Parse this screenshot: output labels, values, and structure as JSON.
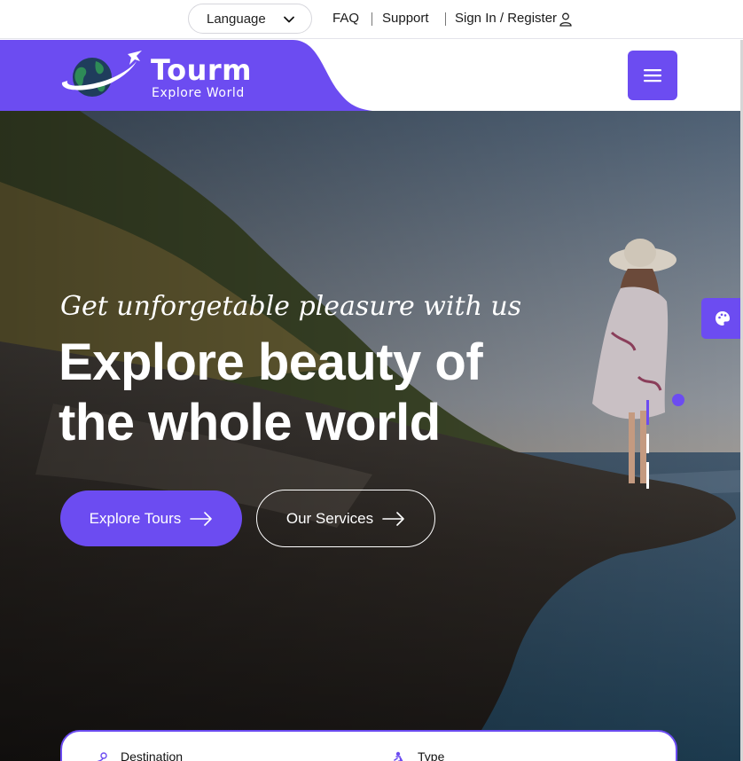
{
  "topbar": {
    "language_label": "Language",
    "links": [
      "FAQ",
      "Support",
      "Sign In / Register"
    ]
  },
  "brand": {
    "name": "Tourm",
    "tagline": "Explore World"
  },
  "hero": {
    "subtitle": "Get unforgetable pleasure with us",
    "title_line1": "Explore beauty of",
    "title_line2": "the whole world",
    "primary_button": "Explore Tours",
    "secondary_button": "Our Services"
  },
  "search": {
    "destination_label": "Destination",
    "type_label": "Type"
  },
  "colors": {
    "accent": "#6c4cf1",
    "text_dark": "#111111",
    "white": "#ffffff"
  },
  "icons": [
    "chevron-down-icon",
    "user-icon",
    "globe-plane-logo",
    "hamburger-menu-icon",
    "arrow-right-icon",
    "palette-icon",
    "map-pin-icon",
    "hiker-icon"
  ]
}
